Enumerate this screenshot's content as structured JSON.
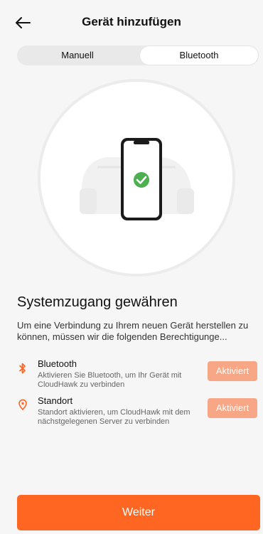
{
  "header": {
    "title": "Gerät hinzufügen",
    "back_icon": "arrow-left-icon"
  },
  "segmented": {
    "options": [
      "Manuell",
      "Bluetooth"
    ],
    "selected": "Bluetooth"
  },
  "hero": {
    "status_icon": "checkmark-icon",
    "check_color": "#4caf50"
  },
  "main": {
    "title": "Systemzugang gewähren",
    "description": "Um eine Verbindung zu Ihrem neuen Gerät herstellen zu können, müssen wir die folgenden Berechtigunge..."
  },
  "permissions": [
    {
      "title": "Bluetooth",
      "desc": "Aktivieren Sie Bluetooth, um Ihr Gerät mit CloudHawk zu verbinden",
      "button": "Aktiviert",
      "icon": "bluetooth-icon"
    },
    {
      "title": "Standort",
      "desc": "Standort aktivieren, um CloudHawk mit dem nächstgelegenen Server zu verbinden",
      "button": "Aktiviert",
      "icon": "location-pin-icon"
    }
  ],
  "footer": {
    "button": "Weiter"
  },
  "colors": {
    "accent": "#ff6621",
    "button_disabled": "#f7a686",
    "segment_bg": "#e9e9e9"
  }
}
